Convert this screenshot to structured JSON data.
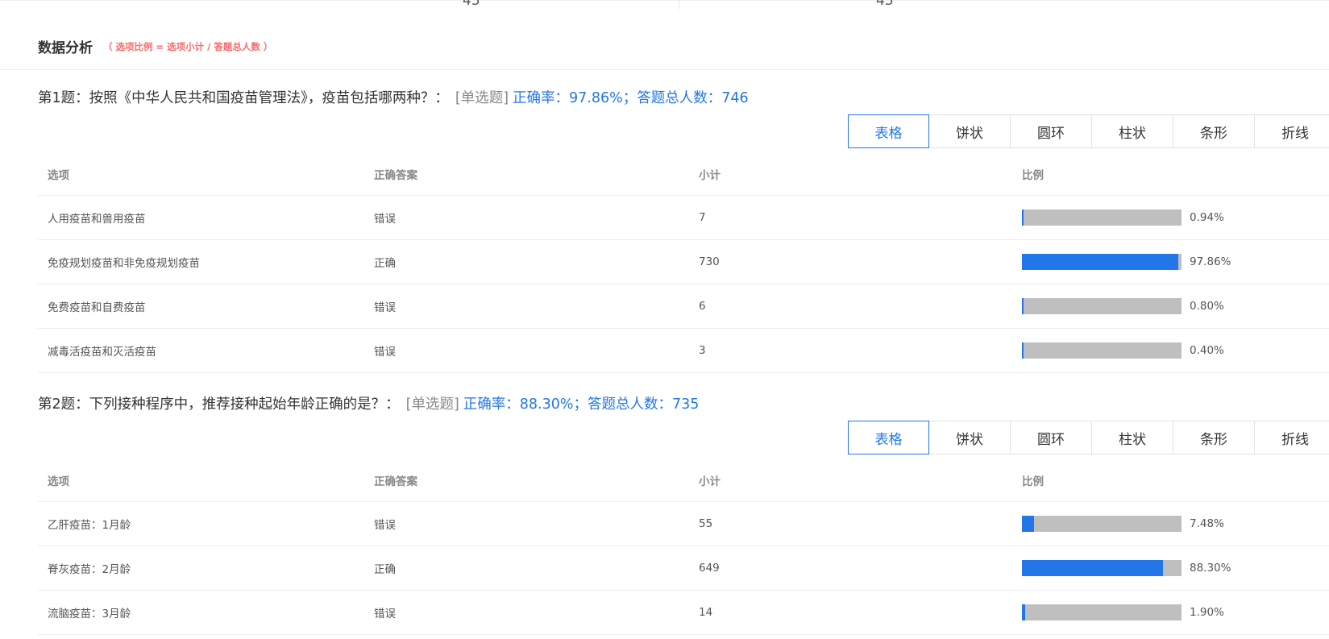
{
  "top_remnant": {
    "left_value": "45",
    "right_value": "45"
  },
  "section": {
    "title": "数据分析",
    "note": "（ 选项比例 = 选项小计 / 答题总人数 ）"
  },
  "tabs": [
    "表格",
    "饼状",
    "圆环",
    "柱状",
    "条形",
    "折线"
  ],
  "table_headers": {
    "option": "选项",
    "answer": "正确答案",
    "count": "小计",
    "ratio": "比例"
  },
  "questions": [
    {
      "title": "第1题：按照《中华人民共和国疫苗管理法》，疫苗包括哪两种？：",
      "type": "[单选题]",
      "stats": "正确率：97.86%；答题总人数：746",
      "rows": [
        {
          "option": "人用疫苗和兽用疫苗",
          "answer": "错误",
          "count": "7",
          "ratio": "0.94%",
          "ratio_value": 0.94
        },
        {
          "option": "免疫规划疫苗和非免疫规划疫苗",
          "answer": "正确",
          "count": "730",
          "ratio": "97.86%",
          "ratio_value": 97.86
        },
        {
          "option": "免费疫苗和自费疫苗",
          "answer": "错误",
          "count": "6",
          "ratio": "0.80%",
          "ratio_value": 0.8
        },
        {
          "option": "减毒活疫苗和灭活疫苗",
          "answer": "错误",
          "count": "3",
          "ratio": "0.40%",
          "ratio_value": 0.4
        }
      ]
    },
    {
      "title": "第2题：下列接种程序中，推荐接种起始年龄正确的是？：",
      "type": "[单选题]",
      "stats": "正确率：88.30%；答题总人数：735",
      "rows": [
        {
          "option": "乙肝疫苗：1月龄",
          "answer": "错误",
          "count": "55",
          "ratio": "7.48%",
          "ratio_value": 7.48
        },
        {
          "option": "脊灰疫苗：2月龄",
          "answer": "正确",
          "count": "649",
          "ratio": "88.30%",
          "ratio_value": 88.3
        },
        {
          "option": "流脑疫苗：3月龄",
          "answer": "错误",
          "count": "14",
          "ratio": "1.90%",
          "ratio_value": 1.9
        }
      ]
    }
  ]
}
